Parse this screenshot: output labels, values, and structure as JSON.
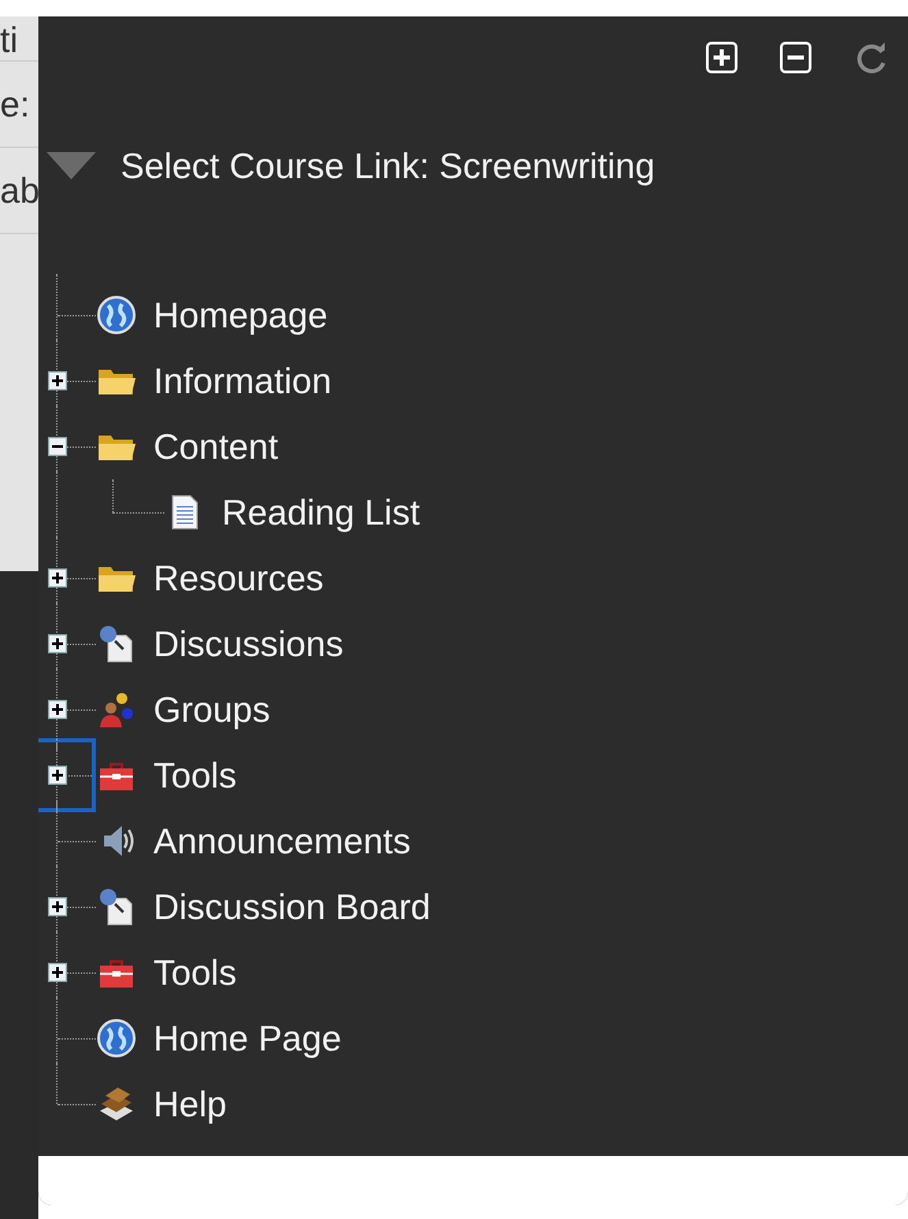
{
  "background_page": {
    "fragments": [
      "ti",
      "e:",
      "ab"
    ]
  },
  "panel": {
    "toolbar": [
      {
        "kind": "expand_all"
      },
      {
        "kind": "collapse_all"
      },
      {
        "kind": "refresh"
      }
    ],
    "heading": "Select Course Link: Screenwriting",
    "tree": [
      {
        "label": "Homepage",
        "kind": "globe",
        "expandable": false,
        "focused": false
      },
      {
        "label": "Information",
        "kind": "folder",
        "expandable": true,
        "expanded": false,
        "focused": false
      },
      {
        "label": "Content",
        "kind": "folder",
        "expandable": true,
        "expanded": true,
        "focused": false,
        "children": [
          {
            "label": "Reading List",
            "kind": "document",
            "expandable": false,
            "focused": false
          }
        ]
      },
      {
        "label": "Resources",
        "kind": "folder",
        "expandable": true,
        "expanded": false,
        "focused": false
      },
      {
        "label": "Discussions",
        "kind": "discussion",
        "expandable": true,
        "expanded": false,
        "focused": false
      },
      {
        "label": "Groups",
        "kind": "group",
        "expandable": true,
        "expanded": false,
        "focused": false
      },
      {
        "label": "Tools",
        "kind": "toolbox",
        "expandable": true,
        "expanded": false,
        "focused": true
      },
      {
        "label": "Announcements",
        "kind": "speaker",
        "expandable": false,
        "focused": false
      },
      {
        "label": "Discussion Board",
        "kind": "discussion",
        "expandable": true,
        "expanded": false,
        "focused": false
      },
      {
        "label": "Tools",
        "kind": "toolbox",
        "expandable": true,
        "expanded": false,
        "focused": false
      },
      {
        "label": "Home Page",
        "kind": "globe",
        "expandable": false,
        "focused": false
      },
      {
        "label": "Help",
        "kind": "book",
        "expandable": false,
        "focused": false
      }
    ]
  }
}
